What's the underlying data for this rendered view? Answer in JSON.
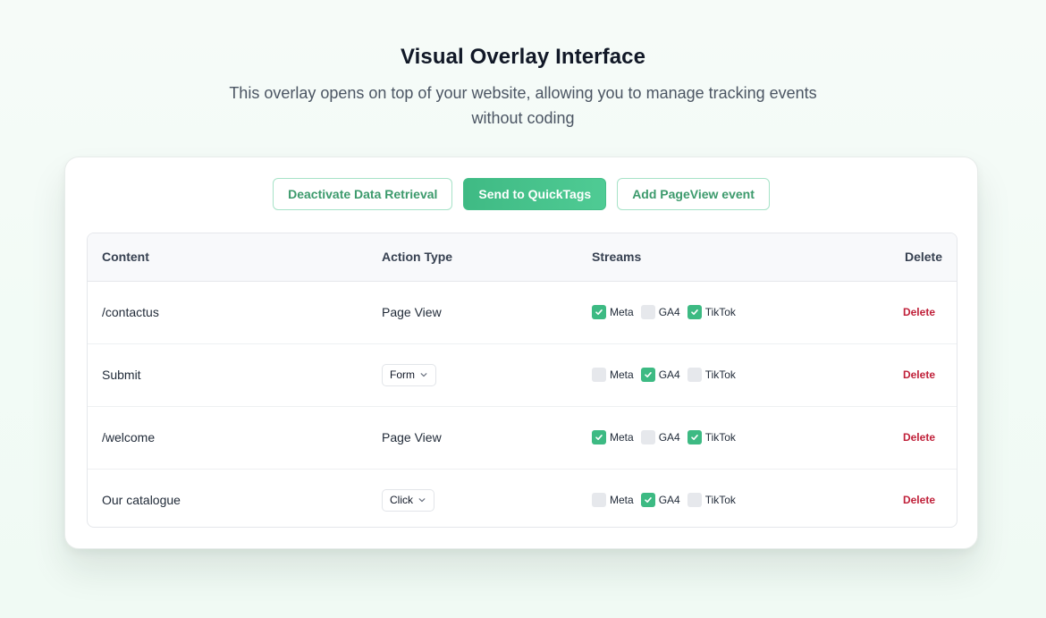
{
  "page": {
    "title": "Visual Overlay Interface",
    "subtitle": "This overlay opens on top of your website, allowing you to manage tracking events without coding"
  },
  "toolbar": {
    "deactivate_label": "Deactivate Data Retrieval",
    "send_label": "Send to QuickTags",
    "add_pageview_label": "Add PageView event"
  },
  "colors": {
    "accent": "#3dba83",
    "delete": "#c0213a",
    "outline_border": "#a7e3c8"
  },
  "table": {
    "columns": {
      "content": "Content",
      "action_type": "Action Type",
      "streams": "Streams",
      "delete": "Delete"
    },
    "rows": [
      {
        "content": "/contactus",
        "action_type": "Page View",
        "action_is_select": false,
        "streams": [
          {
            "name": "Meta",
            "checked": true
          },
          {
            "name": "GA4",
            "checked": false
          },
          {
            "name": "TikTok",
            "checked": true
          }
        ],
        "delete_label": "Delete"
      },
      {
        "content": "Submit",
        "action_type": "Form",
        "action_is_select": true,
        "streams": [
          {
            "name": "Meta",
            "checked": false
          },
          {
            "name": "GA4",
            "checked": true
          },
          {
            "name": "TikTok",
            "checked": false
          }
        ],
        "delete_label": "Delete"
      },
      {
        "content": "/welcome",
        "action_type": "Page View",
        "action_is_select": false,
        "streams": [
          {
            "name": "Meta",
            "checked": true
          },
          {
            "name": "GA4",
            "checked": false
          },
          {
            "name": "TikTok",
            "checked": true
          }
        ],
        "delete_label": "Delete"
      },
      {
        "content": "Our catalogue",
        "action_type": "Click",
        "action_is_select": true,
        "streams": [
          {
            "name": "Meta",
            "checked": false
          },
          {
            "name": "GA4",
            "checked": true
          },
          {
            "name": "TikTok",
            "checked": false
          }
        ],
        "delete_label": "Delete"
      }
    ]
  }
}
